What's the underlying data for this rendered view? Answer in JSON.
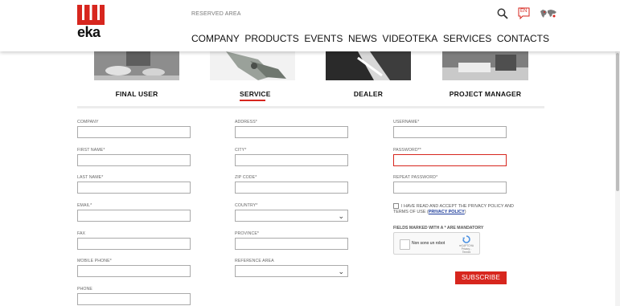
{
  "header": {
    "logo_text": "eka",
    "reserved_area": "RESERVED AREA",
    "language": "EN",
    "nav": [
      "COMPANY",
      "PRODUCTS",
      "EVENTS",
      "NEWS",
      "VIDEOTEKA",
      "SERVICES",
      "CONTACTS"
    ]
  },
  "categories": [
    {
      "label": "FINAL USER",
      "active": false
    },
    {
      "label": "SERVICE",
      "active": true
    },
    {
      "label": "DEALER",
      "active": false
    },
    {
      "label": "PROJECT MANAGER",
      "active": false
    }
  ],
  "form": {
    "col1": {
      "company": "COMPANY",
      "first_name": "FIRST NAME*",
      "last_name": "LAST NAME*",
      "email": "EMAIL*",
      "fax": "FAX",
      "mobile_phone": "MOBILE PHONE*",
      "phone": "PHONE"
    },
    "col2": {
      "address": "ADDRESS*",
      "city": "CITY*",
      "zip_code": "ZIP CODE*",
      "country": "COUNTRY*",
      "province": "PROVINCE*",
      "reference_area": "REFERENCE AREA"
    },
    "col3": {
      "username": "USERNAME*",
      "password": "PASSWORD**",
      "repeat_password": "REPEAT PASSWORD*"
    },
    "privacy_text": "I HAVE READ AND ACCEPT THE PRIVACY POLICY AND TERMS OF USE (",
    "privacy_link": "PRIVACY POLICY",
    "privacy_close": ")",
    "mandatory_note": "FIELDS MARKED WITH A * ARE MANDATORY",
    "captcha_label": "Non sono un robot",
    "captcha_brand": "reCAPTCHA",
    "captcha_terms": "Privacy - Termini",
    "subscribe_label": "SUBSCRIBE"
  },
  "colors": {
    "accent": "#d7261e",
    "link": "#1a3a9a"
  }
}
